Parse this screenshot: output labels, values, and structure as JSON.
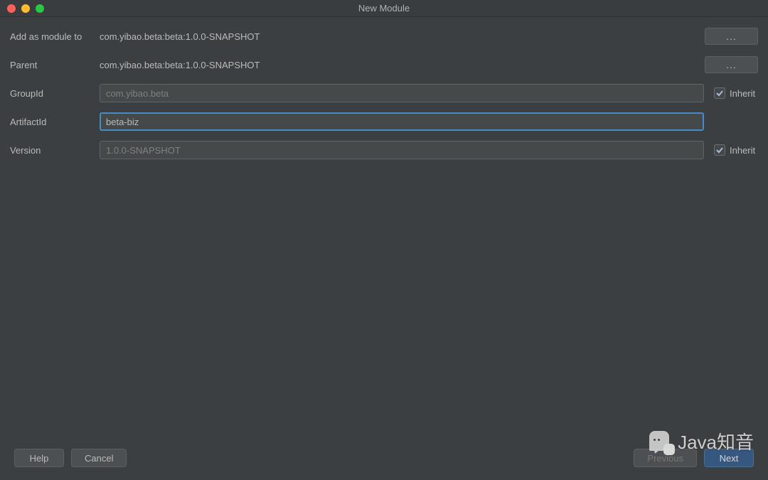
{
  "window": {
    "title": "New Module"
  },
  "form": {
    "addAsModule": {
      "label": "Add as module to",
      "value": "com.yibao.beta:beta:1.0.0-SNAPSHOT",
      "ellipsis": "..."
    },
    "parent": {
      "label": "Parent",
      "value": "com.yibao.beta:beta:1.0.0-SNAPSHOT",
      "ellipsis": "..."
    },
    "groupId": {
      "label": "GroupId",
      "value": "com.yibao.beta",
      "inheritLabel": "Inherit"
    },
    "artifactId": {
      "label": "ArtifactId",
      "value": "beta-biz"
    },
    "version": {
      "label": "Version",
      "value": "1.0.0-SNAPSHOT",
      "inheritLabel": "Inherit"
    }
  },
  "footer": {
    "help": "Help",
    "cancel": "Cancel",
    "previous": "Previous",
    "next": "Next"
  },
  "watermark": "Java知音"
}
